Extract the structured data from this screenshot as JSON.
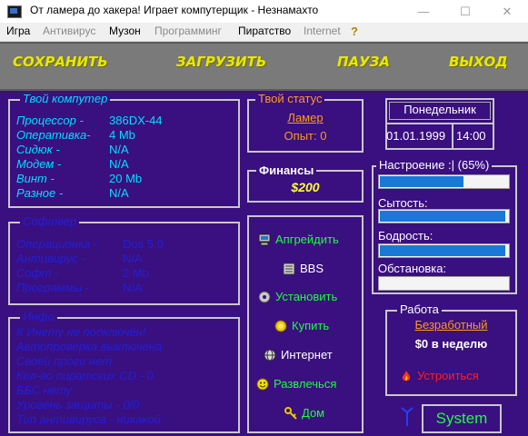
{
  "window": {
    "title": "От ламера до хакера! Играет компутерщик - Незнамахто",
    "minimize": "—",
    "maximize": "☐",
    "close": "✕"
  },
  "menu": {
    "items": [
      "Игра",
      "Антивирус",
      "Музон",
      "Программинг",
      "Пиратство",
      "Internet"
    ],
    "help": "?"
  },
  "toolbar": {
    "save": "СОХРАНИТЬ",
    "load": "ЗАГРУЗИТЬ",
    "pause": "ПАУЗА",
    "exit": "ВЫХОД"
  },
  "computer": {
    "title": "Твой компутер",
    "rows": [
      {
        "label": "Процессор  -",
        "value": "386DX-44"
      },
      {
        "label": "Оперативка-",
        "value": "4 Mb"
      },
      {
        "label": "Сидюк       -",
        "value": "N/A"
      },
      {
        "label": "Модем       -",
        "value": "N/A"
      },
      {
        "label": "Винт         -",
        "value": "20 Mb"
      },
      {
        "label": "Разное      -",
        "value": "N/A"
      }
    ]
  },
  "software": {
    "title": "Софтвер",
    "rows": [
      {
        "label": "Операционка -",
        "value": "Dos 5.0"
      },
      {
        "label": "Антивирус   -",
        "value": "N/A"
      },
      {
        "label": "Софт          -",
        "value": "2 Mb"
      },
      {
        "label": "Программы  -",
        "value": "N/A"
      }
    ]
  },
  "info": {
    "title": "Инфо",
    "lines": [
      "К Инету не подключён!",
      "Автопроверка выключена",
      "Своей проги нет",
      "Кол-во пиратских CD - 0",
      "ББС нету",
      "Уровень защиты - 0/0",
      "Тип антивируса - никакой"
    ]
  },
  "status": {
    "title": "Твой статус",
    "rank": "Ламер",
    "experience": "Опыт: 0"
  },
  "finance": {
    "title": "Финансы",
    "amount": "$200"
  },
  "actions": [
    "Апгрейдить",
    "BBS",
    "Установить",
    "Купить",
    "Интернет",
    "Развлечься",
    "Дом"
  ],
  "datetime": {
    "day": "Понедельник",
    "date": "01.01.1999",
    "time": "14:00"
  },
  "meters": {
    "title": "Настроение :| (65%)",
    "mood": 0.65,
    "satiety_label": "Сытость:",
    "satiety": 0.98,
    "vigor_label": "Бодрость:",
    "vigor": 0.98,
    "environment_label": "Обстановка:",
    "environment": 0
  },
  "job": {
    "title": "Работа",
    "status": "Безработный",
    "salary": "$0 в неделю",
    "apply": "Устроиться"
  },
  "system_button": "System",
  "colors": {
    "background": "#3a0f7f",
    "accent_cyan": "#00dfff",
    "accent_yellow": "#e8e800",
    "accent_green": "#1aff3a",
    "accent_orange": "#ff9a1a",
    "bar_blue": "#1a78d6"
  }
}
